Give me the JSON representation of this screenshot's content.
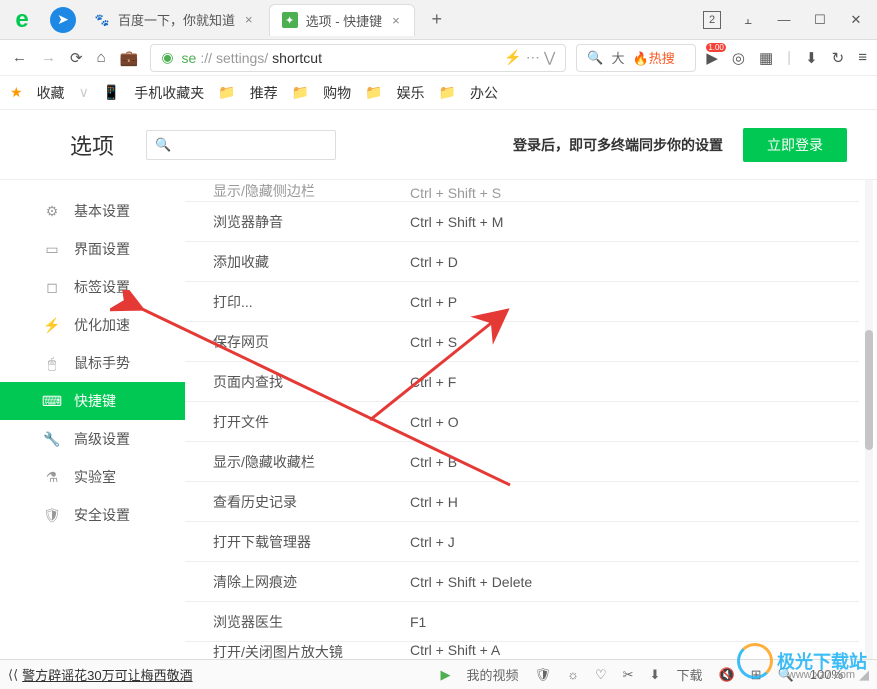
{
  "window": {
    "tabs": [
      {
        "title": "百度一下，你就知道",
        "active": false
      },
      {
        "title": "选项 - 快捷键",
        "active": true
      }
    ],
    "count": "2"
  },
  "address": {
    "scheme": "se",
    "sep": "://",
    "host": "settings/",
    "path": "shortcut",
    "search_hint": "大",
    "hot": "热搜"
  },
  "bookmarks": {
    "fav": "收藏",
    "mobile": "手机收藏夹",
    "items": [
      "推荐",
      "购物",
      "娱乐",
      "办公"
    ]
  },
  "options": {
    "title": "选项",
    "search_placeholder": "",
    "sync_text": "登录后，即可多终端同步你的设置",
    "login": "立即登录"
  },
  "sidebar": [
    {
      "icon": "⚙",
      "label": "基本设置"
    },
    {
      "icon": "▭",
      "label": "界面设置"
    },
    {
      "icon": "◻",
      "label": "标签设置"
    },
    {
      "icon": "⚡",
      "label": "优化加速"
    },
    {
      "icon": "🖱",
      "label": "鼠标手势"
    },
    {
      "icon": "⌨",
      "label": "快捷键",
      "active": true
    },
    {
      "icon": "🔧",
      "label": "高级设置"
    },
    {
      "icon": "⚗",
      "label": "实验室"
    },
    {
      "icon": "🛡",
      "label": "安全设置"
    }
  ],
  "shortcuts": [
    {
      "name": "显示/隐藏侧边栏",
      "key": "Ctrl + Shift + S",
      "clip": "top"
    },
    {
      "name": "浏览器静音",
      "key": "Ctrl + Shift + M"
    },
    {
      "name": "添加收藏",
      "key": "Ctrl + D"
    },
    {
      "name": "打印...",
      "key": "Ctrl + P"
    },
    {
      "name": "保存网页",
      "key": "Ctrl + S"
    },
    {
      "name": "页面内查找",
      "key": "Ctrl + F"
    },
    {
      "name": "打开文件",
      "key": "Ctrl + O"
    },
    {
      "name": "显示/隐藏收藏栏",
      "key": "Ctrl + B"
    },
    {
      "name": "查看历史记录",
      "key": "Ctrl + H"
    },
    {
      "name": "打开下载管理器",
      "key": "Ctrl + J"
    },
    {
      "name": "清除上网痕迹",
      "key": "Ctrl + Shift + Delete"
    },
    {
      "name": "浏览器医生",
      "key": "F1"
    },
    {
      "name": "打开/关闭图片放大镜",
      "key": "Ctrl + Shift + A",
      "clip": "bottom"
    }
  ],
  "status": {
    "news": "警方辟谣花30万可让梅西敬酒",
    "video": "我的视频",
    "download": "下载",
    "zoom": "100%"
  },
  "watermark": {
    "text": "极光下载站",
    "sub": "www.xz7.com"
  }
}
